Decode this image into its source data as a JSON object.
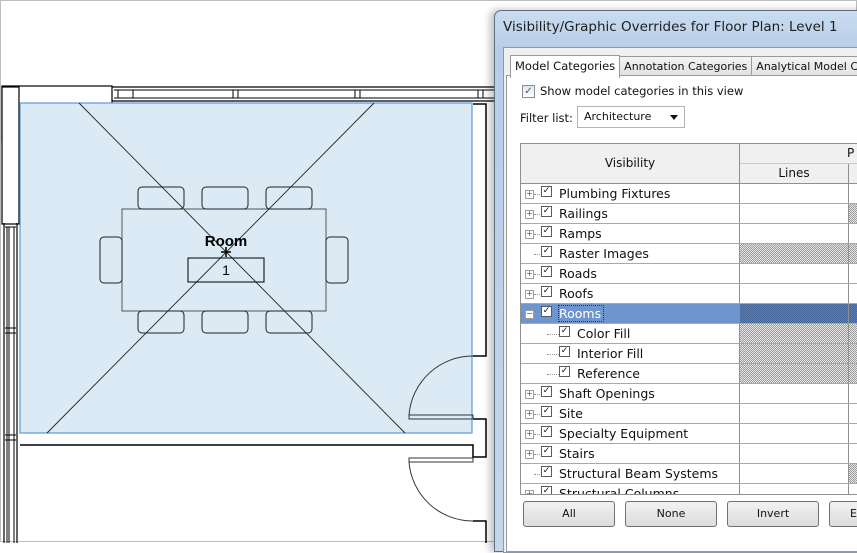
{
  "floor_plan": {
    "room_name": "Room",
    "room_number": "1",
    "room_fill_color": "#dbeaf4",
    "room_boundary_color": "#5b9bd5"
  },
  "dialog": {
    "title": "Visibility/Graphic Overrides for Floor Plan: Level 1",
    "tabs": [
      {
        "label": "Model Categories",
        "active": true
      },
      {
        "label": "Annotation Categories",
        "active": false
      },
      {
        "label": "Analytical Model Categ",
        "active": false
      }
    ],
    "show_categories_label": "Show model categories in this view",
    "show_categories_checked": true,
    "filter_label": "Filter list:",
    "filter_value": "Architecture",
    "grid": {
      "col_visibility": "Visibility",
      "col_group": "P",
      "col_lines": "Lines",
      "rows": [
        {
          "label": "Plumbing Fixtures",
          "checked": true,
          "expander": "+",
          "lines_hatched": false,
          "next_hatched": false
        },
        {
          "label": "Railings",
          "checked": true,
          "expander": "+",
          "lines_hatched": false,
          "next_hatched": true
        },
        {
          "label": "Ramps",
          "checked": true,
          "expander": "+",
          "lines_hatched": false,
          "next_hatched": false
        },
        {
          "label": "Raster Images",
          "checked": true,
          "expander": "",
          "lines_hatched": true,
          "next_hatched": true
        },
        {
          "label": "Roads",
          "checked": true,
          "expander": "+",
          "lines_hatched": false,
          "next_hatched": false
        },
        {
          "label": "Roofs",
          "checked": true,
          "expander": "+",
          "lines_hatched": false,
          "next_hatched": false
        },
        {
          "label": "Rooms",
          "checked": true,
          "expander": "-",
          "selected": true,
          "lines_hatched": true,
          "next_hatched": true
        },
        {
          "label": "Color Fill",
          "checked": true,
          "child": true,
          "lines_hatched": true,
          "next_hatched": true
        },
        {
          "label": "Interior Fill",
          "checked": true,
          "child": true,
          "lines_hatched": true,
          "next_hatched": true
        },
        {
          "label": "Reference",
          "checked": true,
          "child": true,
          "lines_hatched": true,
          "next_hatched": true
        },
        {
          "label": "Shaft Openings",
          "checked": true,
          "expander": "+",
          "lines_hatched": false,
          "next_hatched": false
        },
        {
          "label": "Site",
          "checked": true,
          "expander": "+",
          "lines_hatched": false,
          "next_hatched": false
        },
        {
          "label": "Specialty Equipment",
          "checked": true,
          "expander": "+",
          "lines_hatched": false,
          "next_hatched": false
        },
        {
          "label": "Stairs",
          "checked": true,
          "expander": "+",
          "lines_hatched": false,
          "next_hatched": false
        },
        {
          "label": "Structural Beam Systems",
          "checked": true,
          "expander": "",
          "lines_hatched": false,
          "next_hatched": true
        },
        {
          "label": "Structural Columns",
          "checked": true,
          "expander": "+",
          "lines_hatched": false,
          "next_hatched": false
        }
      ]
    },
    "buttons": {
      "all": "All",
      "none": "None",
      "invert": "Invert",
      "expand": "Ex"
    },
    "selected_row_color": "#6f95cf"
  }
}
